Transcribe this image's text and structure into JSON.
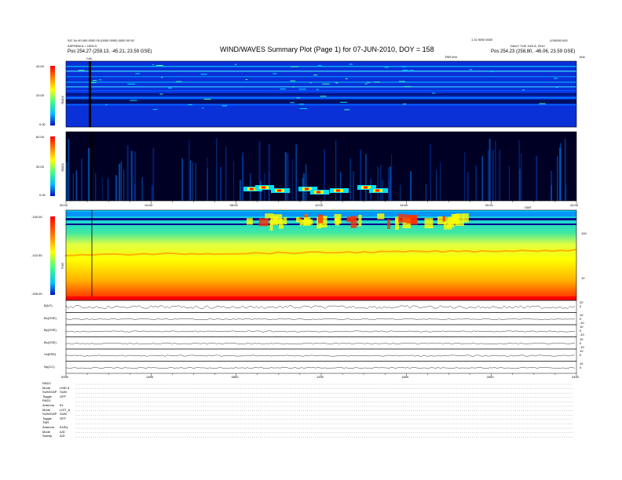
{
  "header": {
    "title": "WIND/WAVES Summary Plot (Page 1) for 07-JUN-2010, DOY = 158",
    "left_line1": "S/C 0x 00 000 0000 00 (0000 0000) 0000 00 00",
    "left_line2": "ASPHEM A = 1500.3",
    "left_line3": "Pos   254.27 (259.13, -45.21, 23.59 GSE)",
    "right_line1": "LIS0000.000",
    "right_line2": "DAILY TUE JUN 8, 2010",
    "right_line3": "Pos   254.23 (258.80, -46.06, 23.59 GSE)",
    "center_small": "1.10 W00 0000",
    "hz_label": "TNR kHz",
    "khz_label": "kHz"
  },
  "rad2": {
    "panel_label": "RAD2",
    "ticks": [
      "40.00",
      "20.00",
      "0.00"
    ]
  },
  "rad1": {
    "panel_label": "RAD1",
    "ticks": [
      "60.00",
      "30.00",
      "0.00"
    ]
  },
  "tnr": {
    "panel_label": "TNR",
    "ticks": [
      "-130.00",
      "-142.50",
      "-155.00"
    ],
    "right_ticks": [
      "100",
      "10"
    ]
  },
  "time_axis_top": [
    "00:00",
    "04:00",
    "08:00",
    "12:00",
    "16:00",
    "20:00",
    "24:00"
  ],
  "time_axis_bottom": [
    "0000",
    "0400",
    "0800",
    "1200",
    "1600",
    "2000",
    "2400"
  ],
  "timeaxis_label": "GMT",
  "cal_label": "CAL",
  "mag": {
    "labels": [
      "B(NT)",
      "Bx(GSE)",
      "By(GSE)",
      "Bz(GSE)",
      "Vs(ESE)",
      "Np(CC)"
    ],
    "right_ticks": [
      [
        "20",
        "0"
      ],
      [
        "10",
        "0",
        "-10"
      ],
      [
        "10",
        "0",
        "-10"
      ],
      [
        "10",
        "0",
        "-10"
      ],
      [
        "10",
        "0"
      ],
      [
        "10",
        "0"
      ]
    ]
  },
  "footer": {
    "blocks": [
      {
        "rows": [
          [
            "RAD2",
            ""
          ],
          [
            "Mode",
            "LINE 8"
          ],
          [
            "SUM/GAP",
            "SUM"
          ],
          [
            "Toggle",
            "OFF"
          ]
        ]
      },
      {
        "rows": [
          [
            "RAD1",
            ""
          ],
          [
            "Antenna",
            "Ex"
          ],
          [
            "Mode",
            "LIST_A"
          ],
          [
            "SUM/GAP",
            "SUM"
          ],
          [
            "Toggle",
            "OFF"
          ]
        ]
      },
      {
        "rows": [
          [
            "TNR",
            ""
          ],
          [
            "Antenna",
            "Ex/Ey"
          ],
          [
            "Mode",
            "A/D"
          ],
          [
            "Sweep",
            "A/D"
          ]
        ]
      }
    ]
  },
  "chart_data": [
    {
      "type": "heatmap",
      "name": "RAD2 spectrogram",
      "x_range": [
        "00:00",
        "24:00"
      ],
      "ylim": [
        0,
        40
      ],
      "color_scale": [
        "#0a0a8a",
        "#0050ff",
        "#00d0ff",
        "#40ff80",
        "#ffff00",
        "#ff8000",
        "#ff0000"
      ]
    },
    {
      "type": "heatmap",
      "name": "RAD1 spectrogram",
      "x_range": [
        "00:00",
        "24:00"
      ],
      "ylim": [
        0,
        60
      ],
      "color_scale": [
        "#000020",
        "#0050ff",
        "#00d0ff",
        "#40ff80",
        "#ffff00",
        "#ff8000",
        "#ff0000"
      ]
    },
    {
      "type": "heatmap",
      "name": "TNR spectrogram",
      "x_range": [
        "00:00",
        "24:00"
      ],
      "ylim": [
        -155,
        -130
      ],
      "color_scale": [
        "#ff0000",
        "#ff8000",
        "#ffff00",
        "#a0ff40",
        "#00e0ff",
        "#0050ff",
        "#0a0a8a"
      ]
    },
    {
      "type": "line",
      "name": "MAG traces",
      "x_range": [
        "0000",
        "2400"
      ],
      "series_count": 6
    }
  ]
}
